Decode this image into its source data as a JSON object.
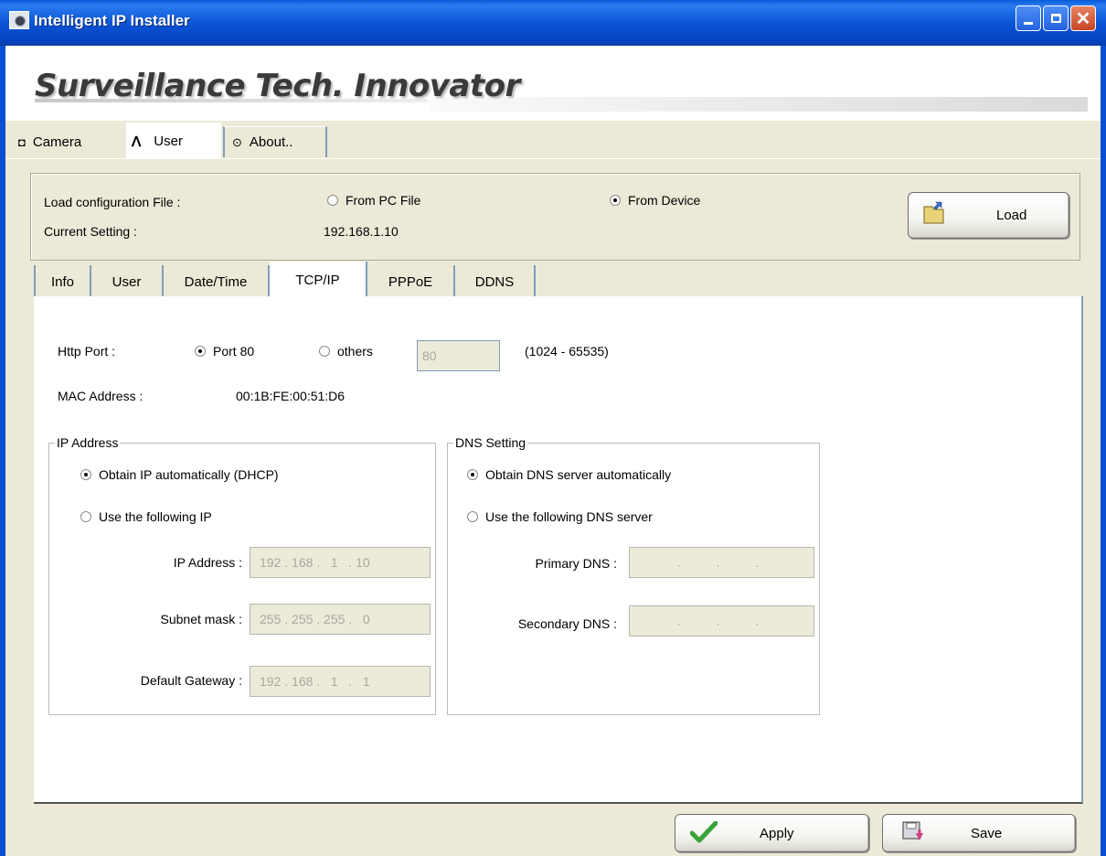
{
  "window": {
    "title": "Intelligent IP Installer"
  },
  "banner": {
    "brand": "Surveillance Tech. Innovator"
  },
  "main_tabs": [
    {
      "label": "Camera",
      "icon": "camera-icon"
    },
    {
      "label": "User",
      "icon": "user-icon",
      "active": true
    },
    {
      "label": "About..",
      "icon": "info-icon"
    }
  ],
  "config": {
    "load_file_label": "Load configuration File :",
    "current_setting_label": "Current Setting :",
    "current_setting_value": "192.168.1.10",
    "from_pc_label": "From PC File",
    "from_device_label": "From Device",
    "selected_source": "From Device",
    "load_button": "Load"
  },
  "sub_tabs": [
    {
      "label": "Info"
    },
    {
      "label": "User"
    },
    {
      "label": "Date/Time"
    },
    {
      "label": "TCP/IP",
      "active": true
    },
    {
      "label": "PPPoE"
    },
    {
      "label": "DDNS"
    }
  ],
  "tcpip": {
    "http_port_label": "Http Port :",
    "port80_label": "Port 80",
    "others_label": "others",
    "others_value": "80",
    "port_range": "(1024 - 65535)",
    "mac_label": "MAC Address :",
    "mac_value": "00:1B:FE:00:51:D6",
    "ip_group": {
      "legend": "IP Address",
      "dhcp_label": "Obtain IP automatically (DHCP)",
      "manual_label": "Use the following IP",
      "ip_label": "IP Address :",
      "ip_value": "192 . 168 .   1   . 10",
      "subnet_label": "Subnet mask :",
      "subnet_value": "255 . 255 . 255 .   0",
      "gateway_label": "Default Gateway :",
      "gateway_value": "192 . 168 .   1   .   1"
    },
    "dns_group": {
      "legend": "DNS Setting",
      "auto_label": "Obtain DNS server automatically",
      "manual_label": "Use the following DNS server",
      "primary_label": "Primary DNS :",
      "primary_value": ".          .          .",
      "secondary_label": "Secondary DNS :",
      "secondary_value": ".          .          ."
    }
  },
  "footer": {
    "apply_button": "Apply",
    "save_button": "Save"
  }
}
